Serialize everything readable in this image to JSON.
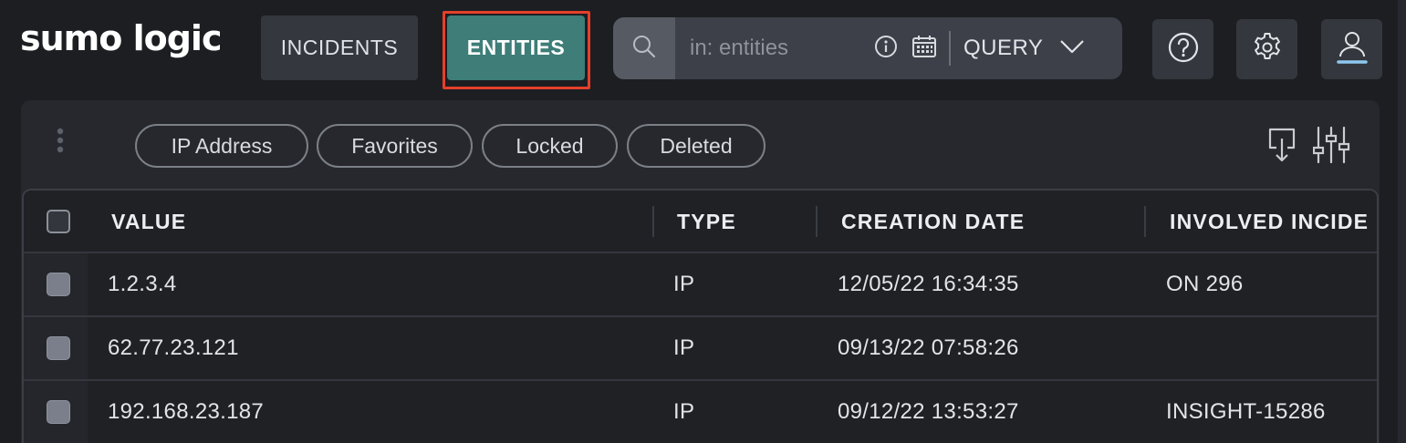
{
  "header": {
    "logo": "sumo logic",
    "nav": [
      {
        "label": "INCIDENTS",
        "active": false
      },
      {
        "label": "ENTITIES",
        "active": true
      }
    ],
    "search": {
      "placeholder": "in: entities",
      "mode_label": "QUERY"
    },
    "icons": [
      "search-icon",
      "info-icon",
      "calendar-icon",
      "chevron-down-icon",
      "help-icon",
      "gear-icon",
      "user-icon"
    ]
  },
  "filters": {
    "chips": [
      "IP Address",
      "Favorites",
      "Locked",
      "Deleted"
    ]
  },
  "table": {
    "columns": [
      "VALUE",
      "TYPE",
      "CREATION DATE",
      "INVOLVED INCIDE"
    ],
    "rows": [
      {
        "value": "1.2.3.4",
        "type": "IP",
        "created": "12/05/22 16:34:35",
        "involved": "ON 296"
      },
      {
        "value": "62.77.23.121",
        "type": "IP",
        "created": "09/13/22 07:58:26",
        "involved": ""
      },
      {
        "value": "192.168.23.187",
        "type": "IP",
        "created": "09/12/22 13:53:27",
        "involved": "INSIGHT-15286"
      }
    ]
  },
  "colors": {
    "accent": "#3e7d78",
    "highlight": "#e4402b",
    "background": "#1c1e22",
    "user_underline": "#8ec8f0"
  }
}
